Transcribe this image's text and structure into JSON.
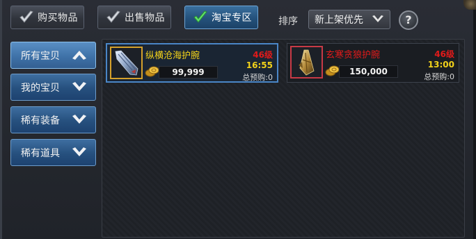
{
  "tabs": [
    {
      "label": "购买物品",
      "active": false
    },
    {
      "label": "出售物品",
      "active": false
    },
    {
      "label": "淘宝专区",
      "active": true
    }
  ],
  "sort": {
    "label": "排序",
    "selected": "新上架优先"
  },
  "help": {
    "label": "?"
  },
  "sidebar": {
    "items": [
      {
        "label": "所有宝贝",
        "expanded": true
      },
      {
        "label": "我的宝贝",
        "expanded": false
      },
      {
        "label": "稀有装备",
        "expanded": false
      },
      {
        "label": "稀有道具",
        "expanded": false
      }
    ]
  },
  "items": [
    {
      "name": "纵横沧海护腕",
      "name_color": "#f2d21a",
      "level": "46级",
      "time": "16:55",
      "presale": "总预购:0",
      "price": "99,999",
      "frame_color": "#d5a12b",
      "icon": "bracer-icon"
    },
    {
      "name": "玄寒贪狼护腕",
      "name_color": "#e21a1a",
      "level": "46级",
      "time": "13:00",
      "presale": "总预购:0",
      "price": "150,000",
      "frame_color": "#c83a46",
      "icon": "bracer-icon"
    }
  ],
  "colors": {
    "accent": "#3f72a8",
    "level": "#e21a1a",
    "time": "#f2d21a"
  }
}
